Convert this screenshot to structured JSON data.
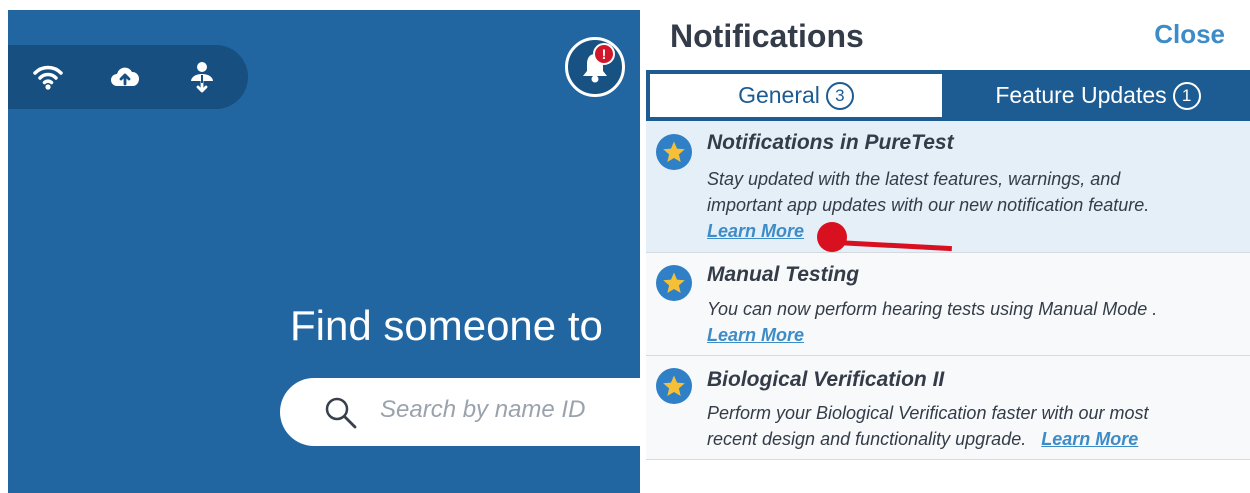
{
  "colors": {
    "background_blue": "#2266a1",
    "status_bar": "#164f80",
    "accent": "#3d8cc7",
    "alert": "#d91020"
  },
  "status_bar": {
    "icons": [
      "wifi-icon",
      "cloud-upload-icon",
      "download-icon"
    ]
  },
  "bell": {
    "badge": "!"
  },
  "main": {
    "heading": "Find someone to",
    "search_placeholder": "Search by name ID"
  },
  "notifications_panel": {
    "title": "Notifications",
    "close_label": "Close",
    "tabs": [
      {
        "label": "General",
        "count": "3",
        "selected": true
      },
      {
        "label": "Feature Updates",
        "count": "1",
        "selected": false
      }
    ],
    "items": [
      {
        "title": "Notifications in PureTest",
        "line1": "Stay updated with the latest features, warnings, and",
        "line2": "important app updates with our new notification feature.",
        "link": "Learn More"
      },
      {
        "title": "Manual Testing",
        "line1": "You can now perform hearing tests using Manual Mode .",
        "link": "Learn More"
      },
      {
        "title": "Biological Verification II",
        "line1": "Perform your Biological Verification faster with our most",
        "line2": "recent design and functionality upgrade.",
        "link": "Learn More"
      }
    ]
  }
}
